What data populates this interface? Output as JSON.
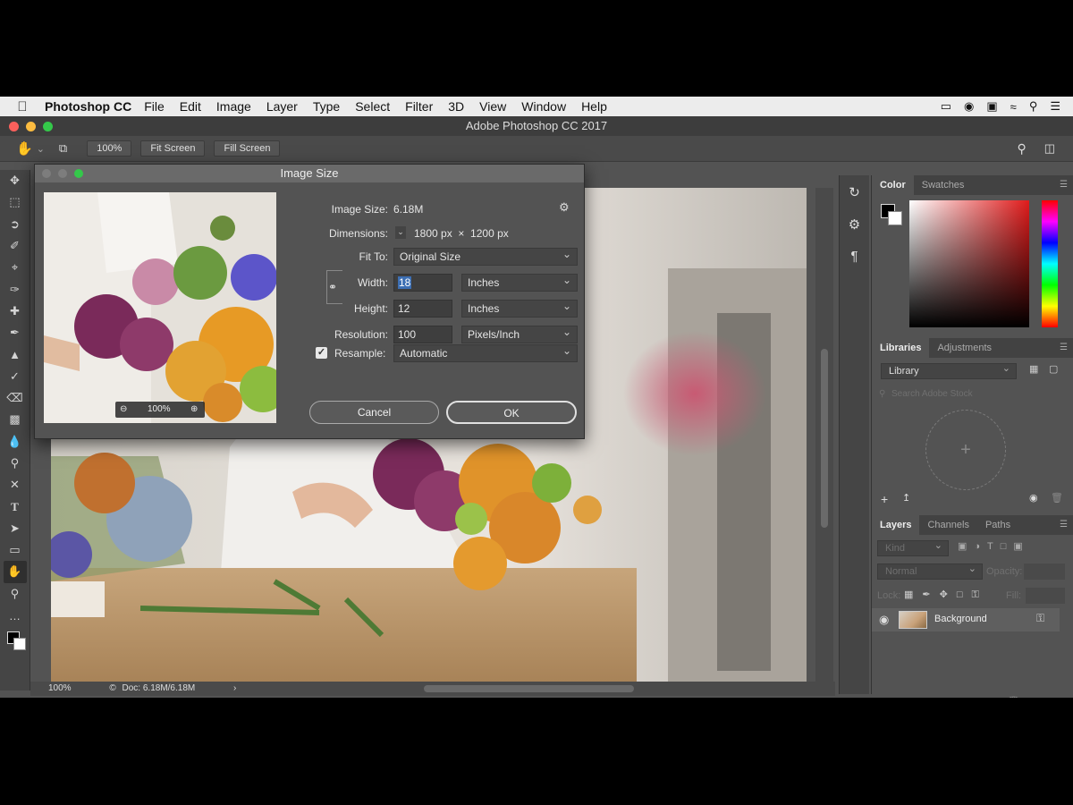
{
  "menubar": {
    "app_name": "Photoshop CC",
    "items": [
      "File",
      "Edit",
      "Image",
      "Layer",
      "Type",
      "Select",
      "Filter",
      "3D",
      "View",
      "Window",
      "Help"
    ]
  },
  "window": {
    "title": "Adobe Photoshop CC 2017"
  },
  "options_bar": {
    "zoom_btn": "100%",
    "fit_screen_btn": "Fit Screen",
    "fill_screen_btn": "Fill Screen"
  },
  "status_bar": {
    "zoom": "100%",
    "doc": "Doc: 6.18M/6.18M"
  },
  "dialog": {
    "title": "Image Size",
    "image_size_label": "Image Size:",
    "image_size_value": "6.18M",
    "dimensions_label": "Dimensions:",
    "dimensions_value": "1800 px  ×  1200 px",
    "fit_to_label": "Fit To:",
    "fit_to_value": "Original Size",
    "width_label": "Width:",
    "width_value": "18",
    "width_unit": "Inches",
    "height_label": "Height:",
    "height_value": "12",
    "height_unit": "Inches",
    "resolution_label": "Resolution:",
    "resolution_value": "100",
    "resolution_unit": "Pixels/Inch",
    "resample_label": "Resample:",
    "resample_checked": true,
    "resample_value": "Automatic",
    "preview_zoom": "100%",
    "cancel_label": "Cancel",
    "ok_label": "OK"
  },
  "panels": {
    "color_tabs": [
      "Color",
      "Swatches"
    ],
    "library_tabs": [
      "Libraries",
      "Adjustments"
    ],
    "library_select": "Library",
    "library_search_placeholder": "Search Adobe Stock",
    "layers_tabs": [
      "Layers",
      "Channels",
      "Paths"
    ],
    "layers_filter": "Kind",
    "blend_mode": "Normal",
    "opacity_label": "Opacity:",
    "lock_label": "Lock:",
    "fill_label": "Fill:",
    "layer_name": "Background"
  },
  "colors": {
    "ok_accent": "#e0e0e0",
    "selection_highlight": "#3d6fb3"
  }
}
